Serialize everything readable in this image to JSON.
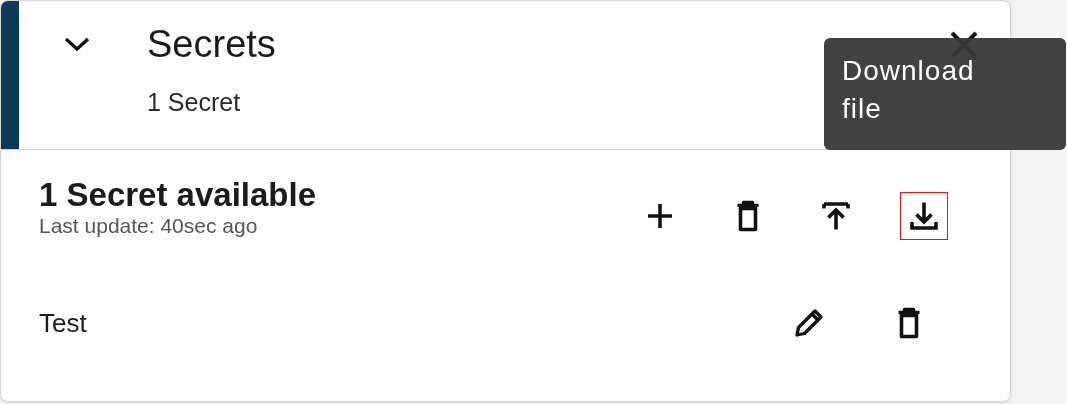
{
  "panel": {
    "title": "Secrets",
    "subtitle": "1 Secret",
    "expanded": true
  },
  "summary": {
    "heading": "1 Secret available",
    "updated": "Last update: 40sec ago"
  },
  "actions": [
    {
      "kind": "add",
      "focused": false
    },
    {
      "kind": "delete",
      "focused": false
    },
    {
      "kind": "upload",
      "focused": false
    },
    {
      "kind": "download",
      "focused": true
    }
  ],
  "tooltip": {
    "text": "Download file"
  },
  "secrets": [
    {
      "name": "Test"
    }
  ]
}
